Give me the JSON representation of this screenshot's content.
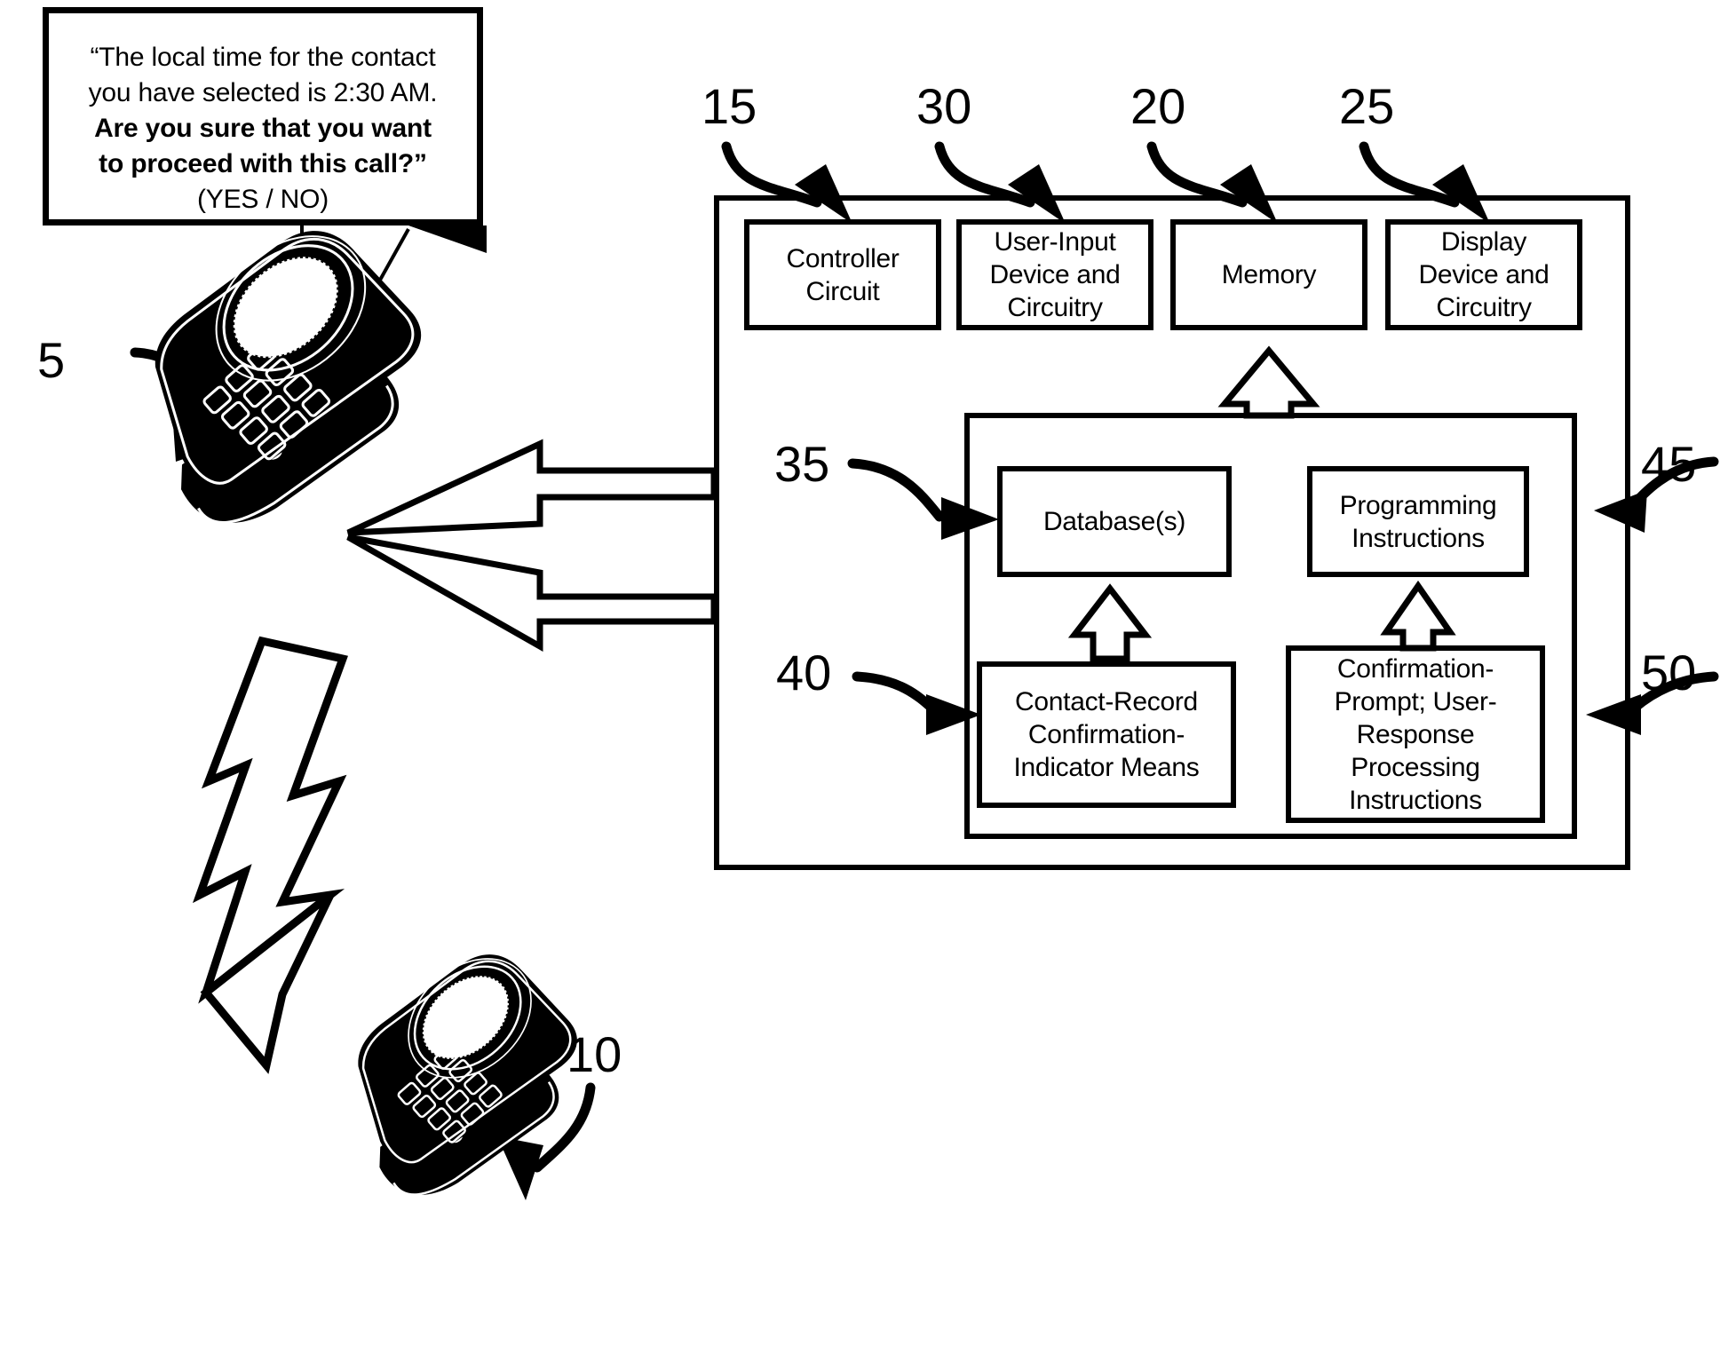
{
  "figure": {
    "type": "patent-block-diagram",
    "callout": {
      "line1": "“The local time for the contact",
      "line2": "you have selected is 2:30 AM.",
      "line3": "Are you sure that you want",
      "line4": "to proceed with this call?”",
      "line5": "(YES / NO)"
    },
    "reference_numerals": [
      {
        "id": "ref-5",
        "label": "5"
      },
      {
        "id": "ref-10",
        "label": "10"
      },
      {
        "id": "ref-15",
        "label": "15"
      },
      {
        "id": "ref-20",
        "label": "20"
      },
      {
        "id": "ref-25",
        "label": "25"
      },
      {
        "id": "ref-30",
        "label": "30"
      },
      {
        "id": "ref-35",
        "label": "35"
      },
      {
        "id": "ref-40",
        "label": "40"
      },
      {
        "id": "ref-45",
        "label": "45"
      },
      {
        "id": "ref-50",
        "label": "50"
      }
    ],
    "blocks": {
      "controller_circuit": {
        "line1": "Controller",
        "line2": "Circuit"
      },
      "user_input_device": {
        "line1": "User-Input",
        "line2": "Device and",
        "line3": "Circuitry"
      },
      "memory": {
        "line1": "Memory"
      },
      "display_device": {
        "line1": "Display",
        "line2": "Device and",
        "line3": "Circuitry"
      },
      "databases": {
        "line1": "Database(s)"
      },
      "programming_instructions": {
        "line1": "Programming",
        "line2": "Instructions"
      },
      "contact_record": {
        "line1": "Contact-Record",
        "line2": "Confirmation-",
        "line3": "Indicator Means"
      },
      "confirmation_prompt": {
        "line1": "Confirmation-",
        "line2": "Prompt; User-",
        "line3": "Response",
        "line4": "Processing",
        "line5": "Instructions"
      }
    },
    "illustrations": {
      "calling_phone": "flip-phone-icon",
      "receiving_phone": "flip-phone-icon",
      "wireless_link": "lightning-bolt-icon"
    },
    "colors": {
      "ink": "#000000",
      "paper": "#ffffff"
    }
  }
}
